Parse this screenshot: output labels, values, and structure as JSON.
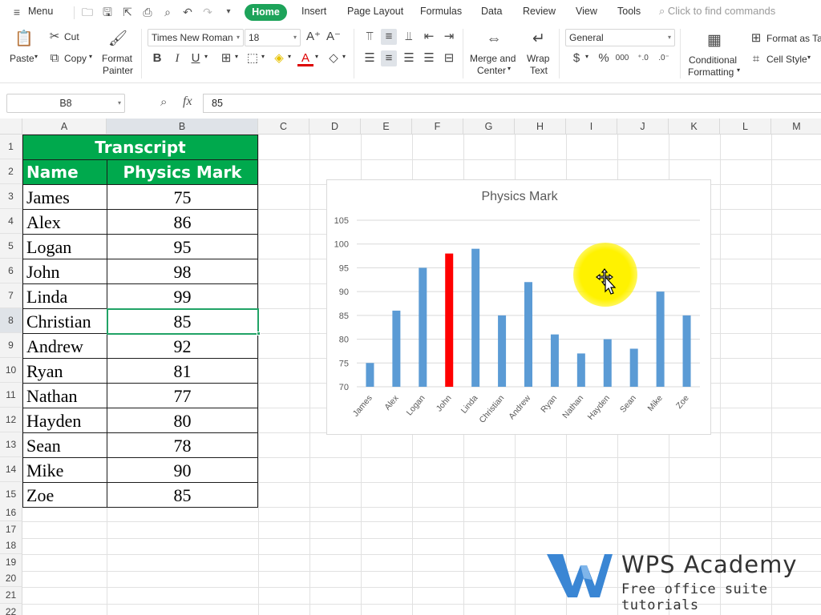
{
  "menubar": {
    "menu_label": "Menu",
    "tabs": [
      "Home",
      "Insert",
      "Page Layout",
      "Formulas",
      "Data",
      "Review",
      "View",
      "Tools"
    ],
    "search_placeholder": "Click to find commands"
  },
  "ribbon": {
    "paste": "Paste",
    "cut": "Cut",
    "copy": "Copy",
    "format_painter_line1": "Format",
    "format_painter_line2": "Painter",
    "font_name": "Times New Roman",
    "font_size": "18",
    "merge_line1": "Merge and",
    "merge_line2": "Center",
    "wrap_line1": "Wrap",
    "wrap_line2": "Text",
    "number_format": "General",
    "conditional_line1": "Conditional",
    "conditional_line2": "Formatting",
    "format_as_table": "Format as Table",
    "cell_style": "Cell Style"
  },
  "formula_bar": {
    "name_box": "B8",
    "fx": "fx",
    "value": "85"
  },
  "columns": [
    "A",
    "B",
    "C",
    "D",
    "E",
    "F",
    "G",
    "H",
    "I",
    "J",
    "K",
    "L",
    "M"
  ],
  "rows": [
    "1",
    "2",
    "3",
    "4",
    "5",
    "6",
    "7",
    "8",
    "9",
    "10",
    "11",
    "12",
    "13",
    "14",
    "15",
    "16",
    "17",
    "18",
    "19",
    "20",
    "21",
    "22"
  ],
  "sheet": {
    "title": "Transcript",
    "header_name": "Name",
    "header_mark": "Physics Mark",
    "records": [
      {
        "name": "James",
        "mark": "75"
      },
      {
        "name": "Alex",
        "mark": "86"
      },
      {
        "name": "Logan",
        "mark": "95"
      },
      {
        "name": "John",
        "mark": "98"
      },
      {
        "name": "Linda",
        "mark": "99"
      },
      {
        "name": "Christian",
        "mark": "85"
      },
      {
        "name": "Andrew",
        "mark": "92"
      },
      {
        "name": "Ryan",
        "mark": "81"
      },
      {
        "name": "Nathan",
        "mark": "77"
      },
      {
        "name": "Hayden",
        "mark": "80"
      },
      {
        "name": "Sean",
        "mark": "78"
      },
      {
        "name": "Mike",
        "mark": "90"
      },
      {
        "name": "Zoe",
        "mark": "85"
      }
    ]
  },
  "chart_data": {
    "type": "bar",
    "title": "Physics Mark",
    "categories": [
      "James",
      "Alex",
      "Logan",
      "John",
      "Linda",
      "Christian",
      "Andrew",
      "Ryan",
      "Nathan",
      "Hayden",
      "Sean",
      "Mike",
      "Zoe"
    ],
    "values": [
      75,
      86,
      95,
      98,
      99,
      85,
      92,
      81,
      77,
      80,
      78,
      90,
      85
    ],
    "ylim": [
      70,
      105
    ],
    "yticks": [
      70,
      75,
      80,
      85,
      90,
      95,
      100,
      105
    ],
    "grid": true,
    "bar_color": "#5b9bd5",
    "highlight_category": "John",
    "highlight_color": "#ff0000"
  },
  "watermark": {
    "brand": "WPS Academy",
    "tagline": "Free office suite tutorials"
  },
  "colors": {
    "accent_green": "#1da35a",
    "header_green": "#00a94d",
    "selection_green": "#21a366",
    "logo_blue": "#3a86d4"
  }
}
